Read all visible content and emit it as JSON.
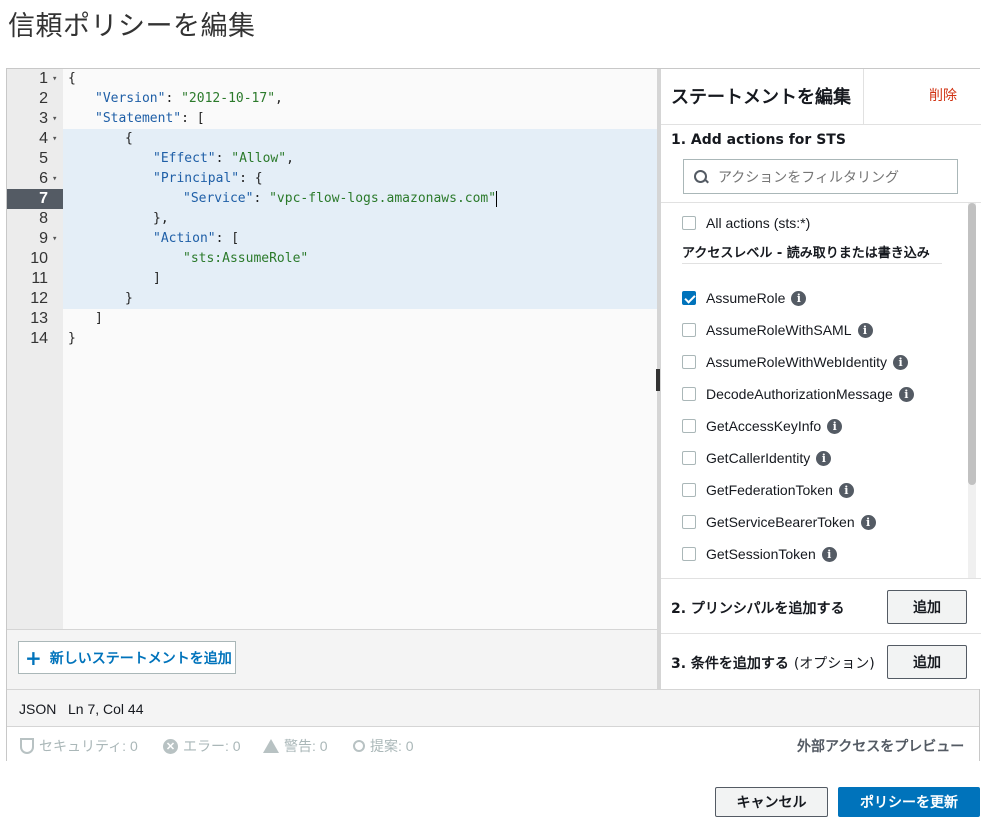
{
  "page": {
    "title": "信頼ポリシーを編集"
  },
  "editor": {
    "lines": [
      {
        "n": "1",
        "fold": true
      },
      {
        "n": "2",
        "fold": false
      },
      {
        "n": "3",
        "fold": true
      },
      {
        "n": "4",
        "fold": true
      },
      {
        "n": "5",
        "fold": false
      },
      {
        "n": "6",
        "fold": true
      },
      {
        "n": "7",
        "fold": false
      },
      {
        "n": "8",
        "fold": false
      },
      {
        "n": "9",
        "fold": true
      },
      {
        "n": "10",
        "fold": false
      },
      {
        "n": "11",
        "fold": false
      },
      {
        "n": "12",
        "fold": false
      },
      {
        "n": "13",
        "fold": false
      },
      {
        "n": "14",
        "fold": false
      }
    ],
    "code": {
      "l1": "{",
      "l2_key": "\"Version\"",
      "l2_val": "\"2012-10-17\"",
      "l3_key": "\"Statement\"",
      "l3_rest": ": [",
      "l4": "{",
      "l5_key": "\"Effect\"",
      "l5_val": "\"Allow\"",
      "l6_key": "\"Principal\"",
      "l6_rest": ": {",
      "l7_key": "\"Service\"",
      "l7_val": "\"vpc-flow-logs.amazonaws.com\"",
      "l8": "},",
      "l9_key": "\"Action\"",
      "l9_rest": ": [",
      "l10_val": "\"sts:AssumeRole\"",
      "l11": "]",
      "l12": "}",
      "l13": "]",
      "l14": "}"
    },
    "active_line": "7",
    "add_statement_label": "新しいステートメントを追加"
  },
  "panel": {
    "title": "ステートメントを編集",
    "delete_label": "削除",
    "section1_title": "1. Add actions for STS",
    "filter_placeholder": "アクションをフィルタリング",
    "all_actions_label": "All actions (sts:*)",
    "access_level_label": "アクセスレベル - 読み取りまたは書き込み",
    "actions": [
      {
        "label": "AssumeRole",
        "checked": true
      },
      {
        "label": "AssumeRoleWithSAML",
        "checked": false
      },
      {
        "label": "AssumeRoleWithWebIdentity",
        "checked": false
      },
      {
        "label": "DecodeAuthorizationMessage",
        "checked": false
      },
      {
        "label": "GetAccessKeyInfo",
        "checked": false
      },
      {
        "label": "GetCallerIdentity",
        "checked": false
      },
      {
        "label": "GetFederationToken",
        "checked": false
      },
      {
        "label": "GetServiceBearerToken",
        "checked": false
      },
      {
        "label": "GetSessionToken",
        "checked": false
      }
    ],
    "info_glyph": "i",
    "section2_label": "2. プリンシパルを追加する",
    "section2_button": "追加",
    "section3_label": "3. 条件を追加する",
    "section3_optional": "(オプション)",
    "section3_button": "追加"
  },
  "status": {
    "mode": "JSON",
    "position": "Ln 7, Col 44"
  },
  "issues": {
    "security": "セキュリティ: 0",
    "errors": "エラー: 0",
    "warnings": "警告: 0",
    "suggestions": "提案: 0",
    "preview_label": "外部アクセスをプレビュー"
  },
  "footer": {
    "cancel_label": "キャンセル",
    "update_label": "ポリシーを更新"
  },
  "colors": {
    "primary": "#0073bb",
    "danger": "#d13212",
    "highlight": "#e4eef7"
  }
}
